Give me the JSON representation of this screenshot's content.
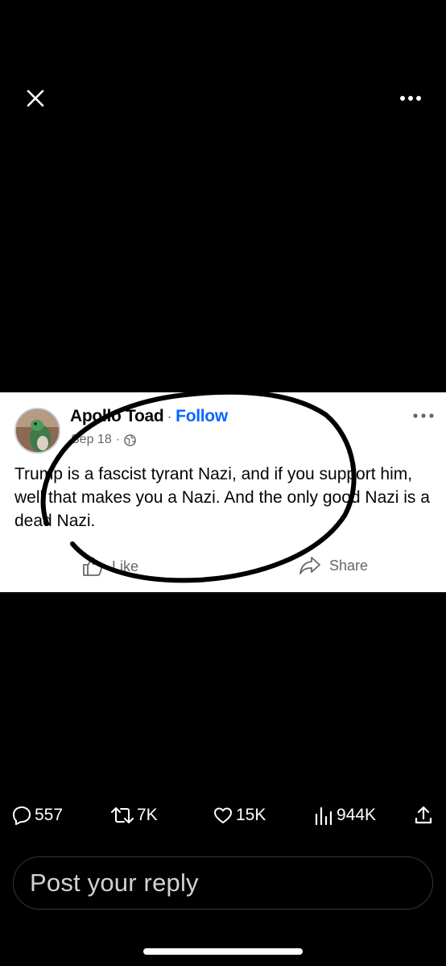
{
  "top_bar": {
    "close_icon": "close-icon",
    "more_icon": "more-horizontal-icon"
  },
  "post_card": {
    "author": "Apollo Toad",
    "separator": "·",
    "follow_label": "Follow",
    "date": "Sep 18",
    "date_separator": "·",
    "audience_icon": "globe-icon",
    "text": "Trump is a fascist tyrant Nazi, and if you support him, well that makes you a Nazi. And the only good Nazi is a dead Nazi.",
    "like_label": "Like",
    "share_label": "Share",
    "accent_color": "#0866ff"
  },
  "annotation": {
    "type": "hand-drawn circle",
    "color": "#000000"
  },
  "stats": {
    "replies": "557",
    "reposts": "7K",
    "likes": "15K",
    "views": "944K"
  },
  "reply": {
    "placeholder": "Post your reply"
  }
}
